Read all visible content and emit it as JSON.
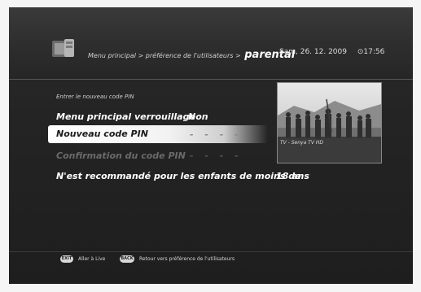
{
  "header": {
    "breadcrumb": "Menu principal > préférence de l'utilisateurs >",
    "current_page": "parental",
    "date": "Sam, 26. 12. 2009",
    "time_icon": "clock-icon",
    "time": "17:56"
  },
  "prompt": "Entrer le nouveau code PIN",
  "rows": [
    {
      "label": "Menu principal verrouillage",
      "value": "Non"
    },
    {
      "label": "Nouveau code PIN",
      "value": "- - - -"
    },
    {
      "label": "Confirmation du code PIN",
      "value": "- - - -"
    },
    {
      "label": "N'est recommandé pour les enfants de moins de",
      "value": "18 ans"
    }
  ],
  "preview": {
    "caption": "TV - Senya TV HD"
  },
  "footer": {
    "exit_key": "EXIT",
    "exit_label": "Aller à Live",
    "back_key": "BACK",
    "back_label": "Retour vers préférence de l'utilisateurs"
  }
}
